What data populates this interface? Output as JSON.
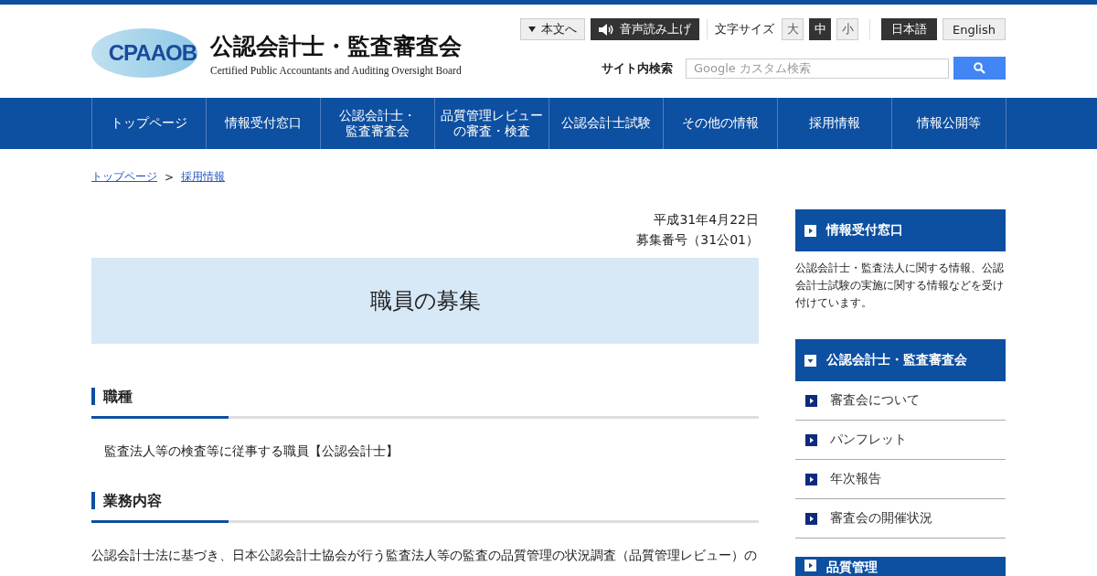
{
  "header": {
    "logo_text": "CPAAOB",
    "title": "公認会計士・監査審査会",
    "subtitle": "Certified Public Accountants and Auditing Oversight Board"
  },
  "utility": {
    "skip_link": "本文へ",
    "read_aloud": "音声読み上げ",
    "font_size_label": "文字サイズ",
    "font_sizes": [
      {
        "label": "大",
        "selected": false
      },
      {
        "label": "中",
        "selected": true
      },
      {
        "label": "小",
        "selected": false
      }
    ],
    "languages": [
      {
        "label": "日本語",
        "selected": true
      },
      {
        "label": "English",
        "selected": false
      }
    ]
  },
  "search": {
    "label": "サイト内検索",
    "placeholder": "Google カスタム検索"
  },
  "nav": [
    {
      "label": "トップページ"
    },
    {
      "label": "情報受付窓口"
    },
    {
      "lines": [
        "公認会計士・",
        "監査審査会"
      ]
    },
    {
      "lines": [
        "品質管理レビュー",
        "の審査・検査"
      ]
    },
    {
      "label": "公認会計士試験"
    },
    {
      "label": "その他の情報"
    },
    {
      "label": "採用情報"
    },
    {
      "label": "情報公開等"
    }
  ],
  "breadcrumb": [
    "トップページ",
    "採用情報"
  ],
  "breadcrumb_separator": ">",
  "main": {
    "date": "平成31年4月22日",
    "number": "募集番号（31公01）",
    "title": "職員の募集",
    "sections": [
      {
        "heading": "職種",
        "body": "監査法人等の検査等に従事する職員【公認会計士】",
        "indent": true
      },
      {
        "heading": "業務内容",
        "body": "公認会計士法に基づき、日本公認会計士協会が行う監査法人等の監査の品質管理の状況調査（品質管理レビュー）の",
        "indent": false
      }
    ]
  },
  "sidebar": [
    {
      "heading": "情報受付窓口",
      "expanded": false,
      "description": "公認会計士・監査法人に関する情報、公認会計士試験の実施に関する情報などを受け付けています。"
    },
    {
      "heading": "公認会計士・監査審査会",
      "expanded": true,
      "links": [
        "審査会について",
        "パンフレット",
        "年次報告",
        "審査会の開催状況"
      ]
    },
    {
      "heading": "品質管理",
      "expanded": false
    }
  ]
}
